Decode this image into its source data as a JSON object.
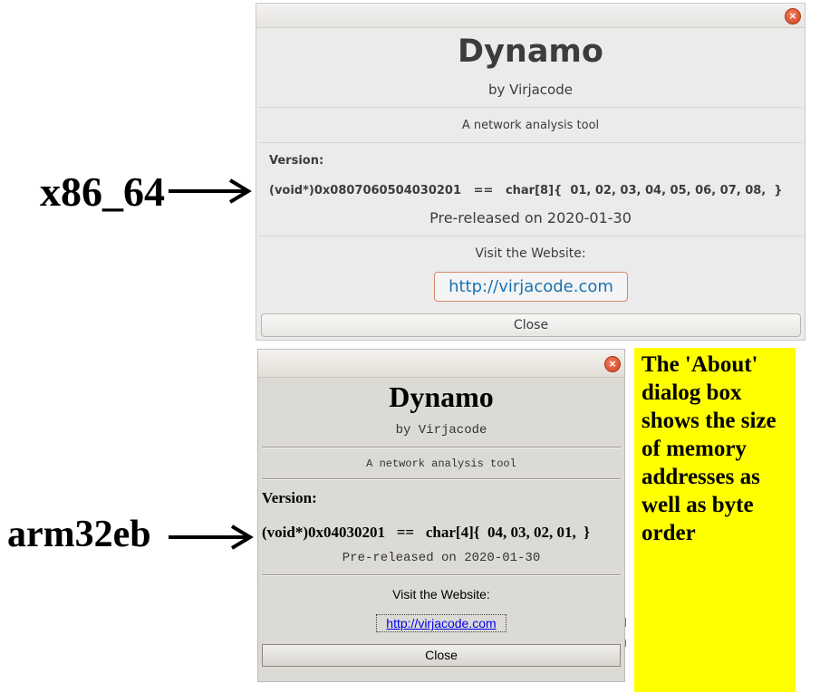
{
  "labels": {
    "top_arch": "x86_64",
    "bottom_arch": "arm32eb"
  },
  "dialog_top": {
    "title": "Dynamo",
    "author": "by Virjacode",
    "description": "A network analysis tool",
    "version_heading": "Version:",
    "version_line": "(void*)0x0807060504030201   ==   char[8]{  01, 02, 03, 04, 05, 06, 07, 08,  }",
    "released": "Pre-released on 2020-01-30",
    "visit_label": "Visit the Website:",
    "website": "http://virjacode.com",
    "close_label": "Close",
    "close_icon": "×"
  },
  "dialog_bottom": {
    "title": "Dynamo",
    "author": "by Virjacode",
    "description": "A network analysis tool",
    "version_heading": "Version:",
    "version_line": "(void*)0x04030201   ==   char[4]{  04, 03, 02, 01,  }",
    "released": "Pre-released on 2020-01-30",
    "visit_label": "Visit the Website:",
    "website": "http://virjacode.com",
    "close_label": "Close",
    "close_icon": "×"
  },
  "note": {
    "text": "The 'About' dialog box shows the size of memory addresses as well as byte order",
    "background": "#ffff00"
  }
}
